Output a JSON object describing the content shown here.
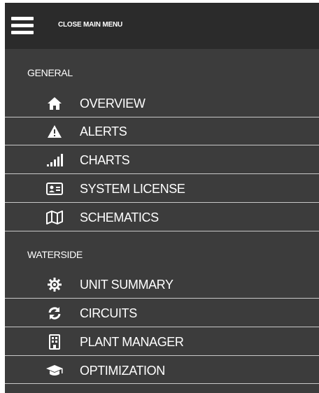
{
  "header": {
    "close_label": "CLOSE MAIN MENU",
    "menu_icon": "hamburger-icon"
  },
  "sections": [
    {
      "title": "GENERAL",
      "items": [
        {
          "label": "OVERVIEW",
          "icon": "home-icon"
        },
        {
          "label": "ALERTS",
          "icon": "warning-icon"
        },
        {
          "label": "CHARTS",
          "icon": "signal-bars-icon"
        },
        {
          "label": "SYSTEM LICENSE",
          "icon": "id-card-icon"
        },
        {
          "label": "SCHEMATICS",
          "icon": "map-icon"
        }
      ]
    },
    {
      "title": "WATERSIDE",
      "items": [
        {
          "label": "UNIT SUMMARY",
          "icon": "cog-icon"
        },
        {
          "label": "CIRCUITS",
          "icon": "refresh-icon"
        },
        {
          "label": "PLANT MANAGER",
          "icon": "building-icon"
        },
        {
          "label": "OPTIMIZATION",
          "icon": "graduation-cap-icon"
        }
      ]
    }
  ],
  "colors": {
    "panel_background": "#3c3c3c",
    "header_background": "#2b2b2b",
    "divider": "#c8c8c8",
    "text": "#ffffff"
  }
}
